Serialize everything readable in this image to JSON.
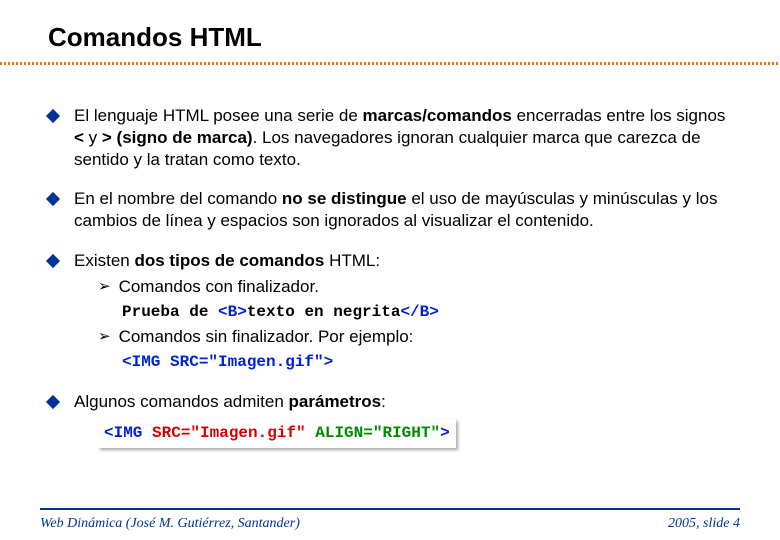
{
  "title": "Comandos HTML",
  "bullets": [
    {
      "parts": [
        {
          "t": "El lenguaje HTML posee una serie de ",
          "b": false
        },
        {
          "t": "marcas/comandos",
          "b": true
        },
        {
          "t": " encerradas entre los signos ",
          "b": false
        },
        {
          "t": "< ",
          "b": true
        },
        {
          "t": "y",
          "b": false
        },
        {
          "t": " > (signo de marca)",
          "b": true
        },
        {
          "t": ". Los navegadores ignoran cualquier marca que carezca de sentido y la tratan como texto.",
          "b": false
        }
      ]
    },
    {
      "parts": [
        {
          "t": "En el nombre del comando ",
          "b": false
        },
        {
          "t": "no se distingue",
          "b": true
        },
        {
          "t": " el uso de mayúsculas y minúsculas y los cambios de línea y espacios son ignorados al visualizar el contenido.",
          "b": false
        }
      ]
    },
    {
      "parts": [
        {
          "t": "Existen ",
          "b": false
        },
        {
          "t": "dos tipos de comandos",
          "b": true
        },
        {
          "t": " HTML:",
          "b": false
        }
      ],
      "subs": [
        {
          "text": "Comandos con finalizador.",
          "code": [
            {
              "t": "Prueba de ",
              "cls": ""
            },
            {
              "t": "<B>",
              "cls": "c-blue"
            },
            {
              "t": "texto en negrita",
              "cls": ""
            },
            {
              "t": "</B>",
              "cls": "c-blue"
            }
          ]
        },
        {
          "text": "Comandos sin finalizador. Por ejemplo:",
          "code": [
            {
              "t": "<IMG SRC=\"Imagen.gif\">",
              "cls": "c-blue"
            }
          ]
        }
      ]
    },
    {
      "parts": [
        {
          "t": "Algunos comandos admiten ",
          "b": false
        },
        {
          "t": "parámetros",
          "b": true
        },
        {
          "t": ":",
          "b": false
        }
      ],
      "boxcode": [
        {
          "t": "<IMG ",
          "cls": "c-blue"
        },
        {
          "t": "SRC=\"Imagen.gif\"",
          "cls": "c-red"
        },
        {
          "t": " ",
          "cls": ""
        },
        {
          "t": "ALIGN=\"RIGHT\"",
          "cls": "c-green"
        },
        {
          "t": ">",
          "cls": "c-blue"
        }
      ]
    }
  ],
  "footer": {
    "left": "Web Dinámica (José M. Gutiérrez, Santander)",
    "right": "2005, slide 4"
  }
}
